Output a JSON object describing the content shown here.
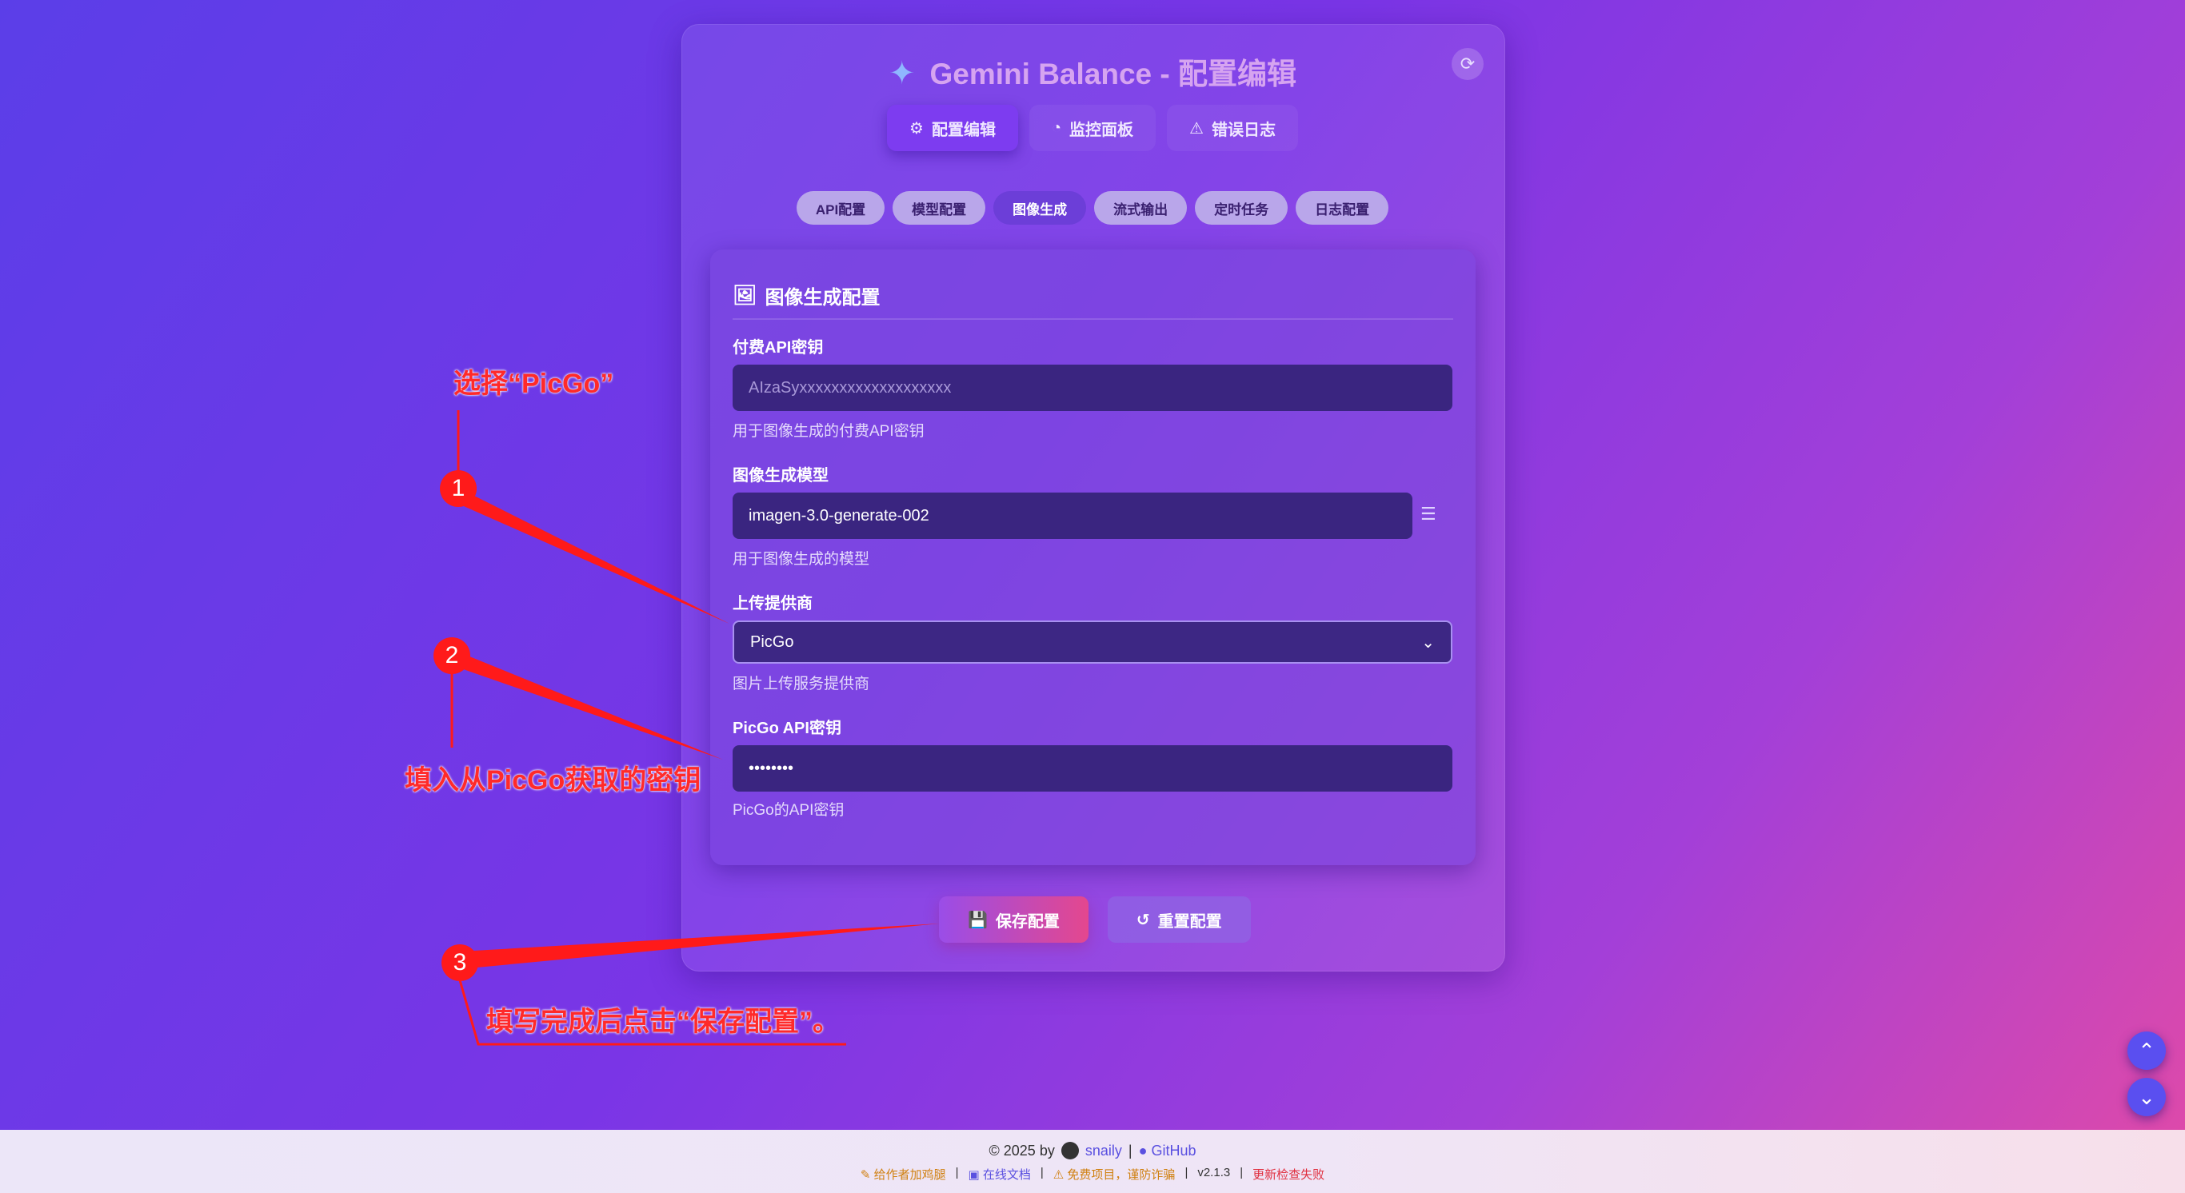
{
  "header": {
    "title": "Gemini Balance - 配置编辑",
    "spark_icon": "sparkle-icon",
    "refresh_icon": "refresh-icon"
  },
  "main_tabs": [
    {
      "label": "配置编辑",
      "icon": "gear-icon",
      "active": true
    },
    {
      "label": "监控面板",
      "icon": "gauge-icon",
      "active": false
    },
    {
      "label": "错误日志",
      "icon": "warning-icon",
      "active": false
    }
  ],
  "sub_tabs": [
    {
      "label": "API配置",
      "active": false
    },
    {
      "label": "模型配置",
      "active": false
    },
    {
      "label": "图像生成",
      "active": true
    },
    {
      "label": "流式输出",
      "active": false
    },
    {
      "label": "定时任务",
      "active": false
    },
    {
      "label": "日志配置",
      "active": false
    }
  ],
  "card": {
    "title": "图像生成配置",
    "title_icon": "image-icon",
    "paid_key": {
      "label": "付费API密钥",
      "placeholder": "AIzaSyxxxxxxxxxxxxxxxxxxx",
      "help": "用于图像生成的付费API密钥"
    },
    "model": {
      "label": "图像生成模型",
      "value": "imagen-3.0-generate-002",
      "help": "用于图像生成的模型",
      "list_icon": "list-icon"
    },
    "provider": {
      "label": "上传提供商",
      "value": "PicGo",
      "help": "图片上传服务提供商",
      "chevron_icon": "chevron-down-icon"
    },
    "picgo_key": {
      "label": "PicGo API密钥",
      "value": "••••••••",
      "help": "PicGo的API密钥"
    }
  },
  "actions": {
    "save_label": "保存配置",
    "reset_label": "重置配置"
  },
  "footer": {
    "copyright": "© 2025 by",
    "author": "snaily",
    "github": "GitHub",
    "sponsor": "给作者加鸡腿",
    "docs": "在线文档",
    "warning": "免费项目，谨防诈骗",
    "version": "v2.1.3",
    "update_status": "更新检查失败"
  },
  "annotations": {
    "step1_num": "1",
    "step1_text": "选择“PicGo”",
    "step2_num": "2",
    "step2_text": "填入从PicGo获取的密钥",
    "step3_num": "3",
    "step3_text": "填写完成后点击“保存配置”。",
    "color": "#ff1a1a"
  }
}
